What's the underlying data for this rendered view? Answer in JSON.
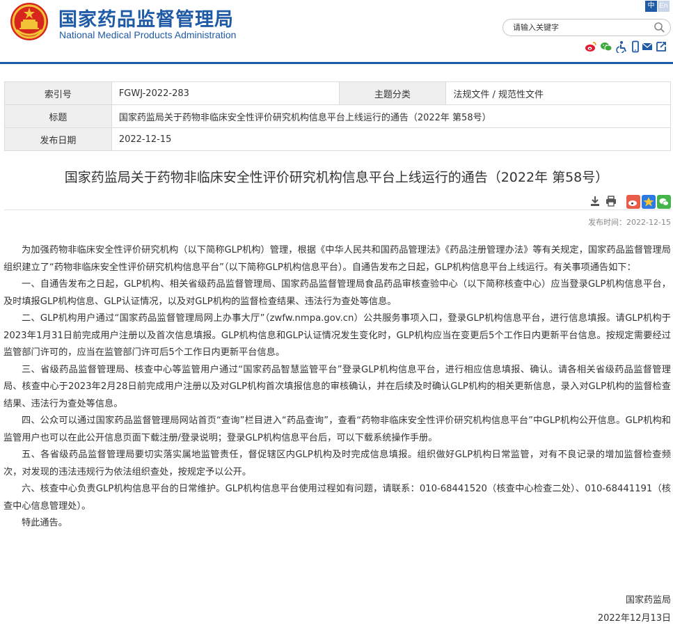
{
  "header": {
    "site_name_cn": "国家药品监督管理局",
    "site_name_en": "National Medical Products Administration",
    "lang_zh": "中",
    "lang_en": "En",
    "search_placeholder": "请输入关键字",
    "social_icons": [
      "weibo-icon",
      "wechat-icon",
      "accessibility-icon",
      "mobile-icon",
      "mail-icon",
      "share-icon"
    ]
  },
  "meta": {
    "index_label": "索引号",
    "index_value": "FGWJ-2022-283",
    "category_label": "主题分类",
    "category_value": "法规文件 / 规范性文件",
    "title_label": "标题",
    "title_value": "国家药监局关于药物非临床安全性评价研究机构信息平台上线运行的通告（2022年 第58号）",
    "date_label": "发布日期",
    "date_value": "2022-12-15"
  },
  "article": {
    "title": "国家药监局关于药物非临床安全性评价研究机构信息平台上线运行的通告（2022年 第58号）",
    "publish_time": "发布时间：2022-12-15",
    "paragraphs": [
      "为加强药物非临床安全性评价研究机构（以下简称GLP机构）管理，根据《中华人民共和国药品管理法》《药品注册管理办法》等有关规定，国家药品监督管理局组织建立了“药物非临床安全性评价研究机构信息平台”（以下简称GLP机构信息平台）。自通告发布之日起，GLP机构信息平台上线运行。有关事项通告如下：",
      "一、自通告发布之日起，GLP机构、相关省级药品监督管理局、国家药品监督管理局食品药品审核查验中心（以下简称核查中心）应当登录GLP机构信息平台，及时填报GLP机构信息、GLP认证情况，以及对GLP机构的监督检查结果、违法行为查处等信息。",
      "二、GLP机构用户通过“国家药品监督管理局网上办事大厅”（zwfw.nmpa.gov.cn）公共服务事项入口，登录GLP机构信息平台，进行信息填报。请GLP机构于2023年1月31日前完成用户注册以及首次信息填报。GLP机构信息和GLP认证情况发生变化时，GLP机构应当在变更后5个工作日内更新平台信息。按规定需要经过监管部门许可的，应当在监管部门许可后5个工作日内更新平台信息。",
      "三、省级药品监督管理局、核查中心等监管用户通过“国家药品智慧监管平台”登录GLP机构信息平台，进行相应信息填报、确认。请各相关省级药品监督管理局、核查中心于2023年2月28日前完成用户注册以及对GLP机构首次填报信息的审核确认，并在后续及时确认GLP机构的相关更新信息，录入对GLP机构的监督检查结果、违法行为查处等信息。",
      "四、公众可以通过国家药品监督管理局网站首页“查询”栏目进入“药品查询”，查看“药物非临床安全性评价研究机构信息平台”中GLP机构公开信息。GLP机构和监管用户也可以在此公开信息页面下载注册/登录说明；登录GLP机构信息平台后，可以下载系统操作手册。",
      "五、各省级药品监督管理局要切实落实属地监管责任，督促辖区内GLP机构及时完成信息填报。组织做好GLP机构日常监管，对有不良记录的增加监督检查频次，对发现的违法违规行为依法组织查处，按规定予以公开。",
      "六、核查中心负责GLP机构信息平台的日常维护。GLP机构信息平台使用过程如有问题，请联系：010-68441520（核查中心检查二处）、010-68441191（核查中心信息管理处）。",
      "特此通告。"
    ],
    "signature_org": "国家药监局",
    "signature_date": "2022年12月13日"
  },
  "colors": {
    "brand_blue": "#1f5aa6",
    "emblem_red": "#d7261e",
    "emblem_gold": "#f3c337",
    "meta_label_bg": "#efefef"
  }
}
